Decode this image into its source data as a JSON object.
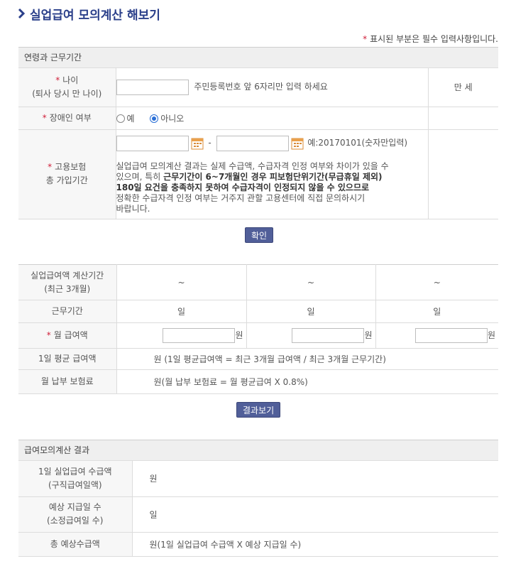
{
  "page": {
    "title": "실업급여 모의계산 해보기",
    "required_note": "표시된 부분은 필수 입력사항입니다.",
    "required_mark": "*"
  },
  "section1": {
    "heading": "연령과 근무기간",
    "age": {
      "label_line1": "나이",
      "label_line2": "(퇴사 당시 만 나이)",
      "input_value": "",
      "hint": "주민등록번호 앞 6자리만 입력 하세요",
      "result": "만 세"
    },
    "disability": {
      "label": "장애인 여부",
      "option_yes": "예",
      "option_no": "아니오",
      "selected": "아니오"
    },
    "insurance": {
      "label_line1": "고용보험",
      "label_line2": "총 가입기간",
      "start_value": "",
      "end_value": "",
      "separator": "-",
      "example": "예:20170101(숫자만입력)",
      "notice_line1": "실업급여 모의계산 결과는 실제 수급액, 수급자격 인정 여부와 차이가 있을 수",
      "notice_line2_plain": "있으며, 특히 ",
      "notice_line2_bold": "근무기간이 6~7개월인 경우 피보험단위기간(무급휴일 제외)",
      "notice_line3_bold": "180일 요건을 충족하지 못하여 수급자격이 인정되지 않을 수 있으므로",
      "notice_line4": "정확한 수급자격 인정 여부는 거주지 관할 고용센터에 직접 문의하시기",
      "notice_line5": "바랍니다."
    },
    "confirm_button": "확인"
  },
  "section2": {
    "period_label_line1": "실업급여액 계산기간",
    "period_label_line2": "(최근 3개월)",
    "periods": [
      "~",
      "~",
      "~"
    ],
    "workdays_label": "근무기간",
    "workdays_unit": "일",
    "monthly_label": "월 급여액",
    "monthly_unit": "원",
    "monthly_values": [
      "",
      "",
      ""
    ],
    "avg_label": "1일 평균 급여액",
    "avg_value": "원 (1일 평균급여액 = 최근 3개월 급여액 / 최근 3개월 근무기간)",
    "premium_label": "월 납부 보험료",
    "premium_value": "원(월 납부 보험료 = 월 평균급여 X 0.8%)",
    "result_button": "결과보기"
  },
  "section3": {
    "heading": "급여모의계산 결과",
    "daily_label_line1": "1일 실업급여 수급액",
    "daily_label_line2": "(구직급여일액)",
    "daily_value": "원",
    "days_label_line1": "예상 지급일 수",
    "days_label_line2": "(소정급여일 수)",
    "days_value": "일",
    "total_label": "총 예상수급액",
    "total_value": "원(1일 실업급여 수급액 X 예상 지급일 수)"
  }
}
